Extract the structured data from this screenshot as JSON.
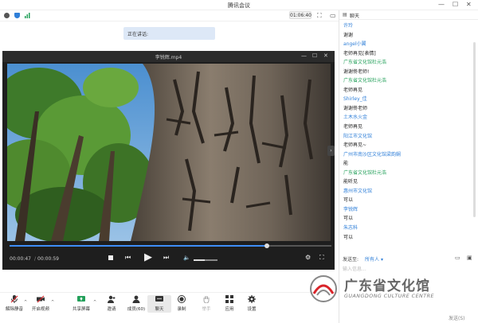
{
  "window": {
    "title": "腾讯会议"
  },
  "topbar": {
    "timer": "01:06:40"
  },
  "speaking": {
    "label": "正在讲话:"
  },
  "player": {
    "title": "李锐辉.mp4",
    "current_time": "00:00:47",
    "total_time": "00:00:59",
    "progress": 0.8,
    "volume": 0.45
  },
  "toolbar": {
    "items": [
      {
        "label": "解除静音",
        "name": "unmute-button"
      },
      {
        "label": "开启视频",
        "name": "start-video-button"
      },
      {
        "label": "共享屏幕",
        "name": "share-screen-button"
      },
      {
        "label": "邀请",
        "name": "invite-button"
      },
      {
        "label": "成员(60)",
        "name": "members-button"
      },
      {
        "label": "聊天",
        "name": "chat-button"
      },
      {
        "label": "录制",
        "name": "record-button"
      },
      {
        "label": "举手",
        "name": "raise-hand-button"
      },
      {
        "label": "应用",
        "name": "apps-button"
      },
      {
        "label": "设置",
        "name": "settings-button"
      }
    ]
  },
  "chat": {
    "title": "聊天",
    "messages": [
      {
        "text": "许玲",
        "kind": "name"
      },
      {
        "text": "谢谢",
        "kind": "text"
      },
      {
        "text": "angel小翼",
        "kind": "name"
      },
      {
        "text": "老师再见[表情]",
        "kind": "text"
      },
      {
        "text": "广东省文化馆杜元浩",
        "kind": "name-green"
      },
      {
        "text": "谢谢佟老师!",
        "kind": "text"
      },
      {
        "text": "广东省文化馆杜元浩",
        "kind": "name-green"
      },
      {
        "text": "老师再见",
        "kind": "text"
      },
      {
        "text": "Shirley_佳",
        "kind": "name"
      },
      {
        "text": "谢谢佟老师",
        "kind": "text"
      },
      {
        "text": "土木水火金",
        "kind": "name"
      },
      {
        "text": "老师再见",
        "kind": "text"
      },
      {
        "text": "阳江市文化馆",
        "kind": "name"
      },
      {
        "text": "老师再见~",
        "kind": "text"
      },
      {
        "text": "广州市南沙区文化馆梁韵娴",
        "kind": "name"
      },
      {
        "text": "能",
        "kind": "text"
      },
      {
        "text": "广东省文化馆杜元浩",
        "kind": "name-green"
      },
      {
        "text": "能听见",
        "kind": "text"
      },
      {
        "text": "惠州市文化馆",
        "kind": "name"
      },
      {
        "text": "可以",
        "kind": "text"
      },
      {
        "text": "李锐辉",
        "kind": "name"
      },
      {
        "text": "可以",
        "kind": "text"
      },
      {
        "text": "朱志科",
        "kind": "name"
      },
      {
        "text": "可以",
        "kind": "text"
      }
    ],
    "send_to_label": "发送至:",
    "send_to_value": "所有人",
    "input_placeholder": "输入信息...",
    "send_button": "发送(S)"
  },
  "watermark": {
    "cn": "广东省文化馆",
    "en": "GUANGDONG CULTURE CENTRE"
  },
  "colors": {
    "accent": "#2f7fd8",
    "green": "#23a05a",
    "red": "#d9252a",
    "panel_dark": "#1e1e1e"
  }
}
